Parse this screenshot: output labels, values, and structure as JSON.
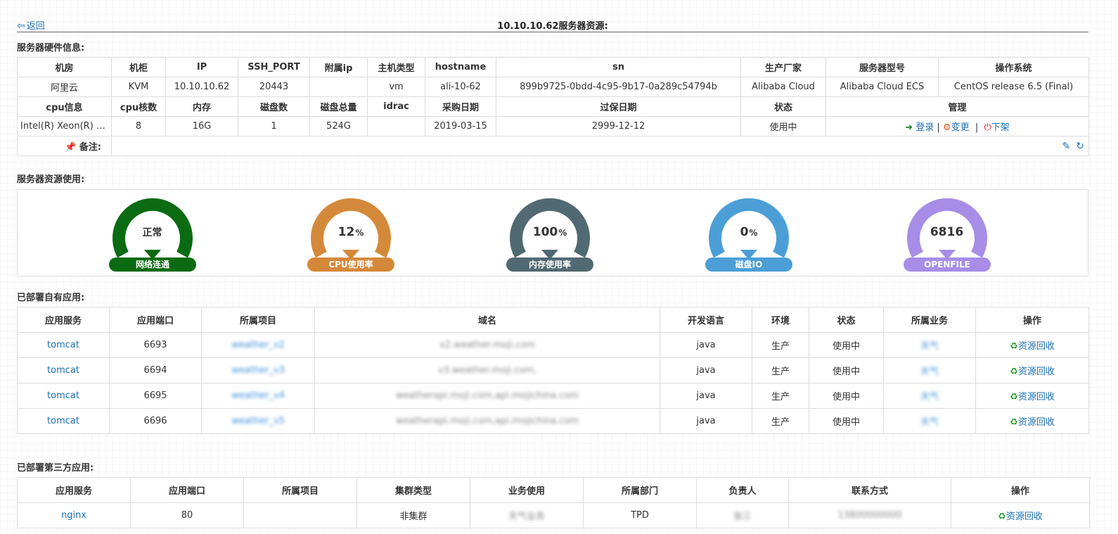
{
  "nav": {
    "back_label": "返回",
    "page_title": "10.10.10.62服务器资源:"
  },
  "hardware": {
    "section_title": "服务器硬件信息:",
    "head1": [
      "机房",
      "机柜",
      "IP",
      "SSH_PORT",
      "附属ip",
      "主机类型",
      "hostname",
      "sn",
      "生产厂家",
      "服务器型号",
      "操作系统"
    ],
    "row1": [
      "阿里云",
      "KVM",
      "10.10.10.62",
      "20443",
      "",
      "vm",
      "ali-10-62",
      "899b9725-0bdd-4c95-9b17-0a289c54794b",
      "Alibaba Cloud",
      "Alibaba Cloud ECS",
      "CentOS release 6.5 (Final)"
    ],
    "head2": [
      "cpu信息",
      "cpu核数",
      "内存",
      "磁盘数",
      "磁盘总量",
      "idrac",
      "采购日期",
      "过保日期",
      "状态",
      "管理"
    ],
    "row2": [
      "Intel(R) Xeon(R) CPU E5-2682 v4 @ 2.50GHz",
      "8",
      "16G",
      "1",
      "524G",
      "",
      "2019-03-15",
      "2999-12-12",
      "使用中"
    ],
    "manage": {
      "login": "登录",
      "change": "变更",
      "offline": "下架",
      "sep": "|"
    },
    "remark_label": "备注:",
    "remark_value": ""
  },
  "usage": {
    "section_title": "服务器资源使用:",
    "gauges": [
      {
        "value": "正常",
        "unit": "",
        "label": "网络连通",
        "color": "#0a6b12"
      },
      {
        "value": "12",
        "unit": "%",
        "label": "CPU使用率",
        "color": "#d4893a"
      },
      {
        "value": "100",
        "unit": "%",
        "label": "内存使用率",
        "color": "#516972"
      },
      {
        "value": "0",
        "unit": "%",
        "label": "磁盘IO",
        "color": "#4b9fd6"
      },
      {
        "value": "6816",
        "unit": "",
        "label": "OPENFILE",
        "color": "#a78de6"
      }
    ]
  },
  "own_apps": {
    "section_title": "已部署自有应用:",
    "columns": [
      "应用服务",
      "应用端口",
      "所属项目",
      "域名",
      "开发语言",
      "环境",
      "状态",
      "所属业务",
      "操作"
    ],
    "rows": [
      {
        "service": "tomcat",
        "port": "6693",
        "project": "weather_v2",
        "domain": "v2.weather.moji.com",
        "lang": "java",
        "env": "生产",
        "status": "使用中",
        "biz": "天气",
        "action": "资源回收"
      },
      {
        "service": "tomcat",
        "port": "6694",
        "project": "weather_v3",
        "domain": "v3.weather.moji.com,",
        "lang": "java",
        "env": "生产",
        "status": "使用中",
        "biz": "天气",
        "action": "资源回收"
      },
      {
        "service": "tomcat",
        "port": "6695",
        "project": "weather_v4",
        "domain": "weatherapi.moji.com,api.mojichina.com",
        "lang": "java",
        "env": "生产",
        "status": "使用中",
        "biz": "天气",
        "action": "资源回收"
      },
      {
        "service": "tomcat",
        "port": "6696",
        "project": "weather_v5",
        "domain": "weatherapi.moji.com,api.mojichina.com",
        "lang": "java",
        "env": "生产",
        "status": "使用中",
        "biz": "天气",
        "action": "资源回收"
      }
    ]
  },
  "third_apps": {
    "section_title": "已部署第三方应用:",
    "columns": [
      "应用服务",
      "应用端口",
      "所属项目",
      "集群类型",
      "业务使用",
      "所属部门",
      "负责人",
      "联系方式",
      "操作"
    ],
    "rows": [
      {
        "service": "nginx",
        "port": "80",
        "project": "",
        "cluster": "非集群",
        "usage": "天气业务",
        "dept": "TPD",
        "owner": "张三",
        "contact": "13800000000",
        "action": "资源回收"
      }
    ]
  }
}
